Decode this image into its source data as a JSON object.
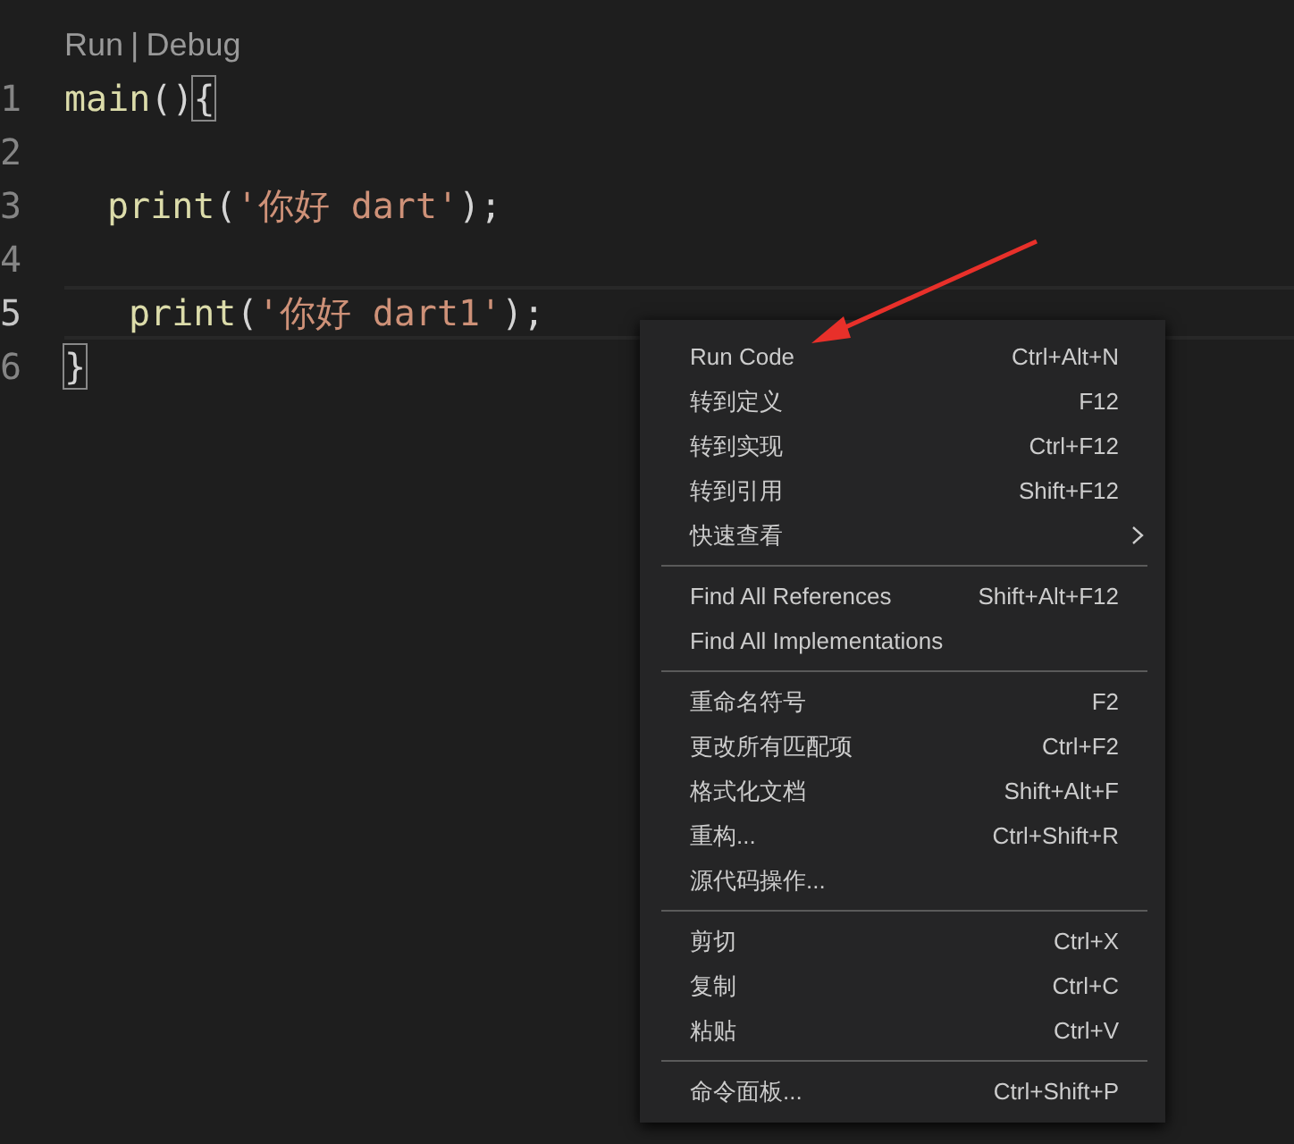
{
  "code_lens": {
    "run": "Run",
    "separator": "|",
    "debug": "Debug"
  },
  "lines": [
    {
      "number": "1",
      "current": false,
      "kind": "top",
      "tokens": [
        {
          "kind": "function",
          "text": "main"
        },
        {
          "kind": "punct",
          "text": "()"
        },
        {
          "kind": "bracket_match",
          "text": "{"
        }
      ]
    },
    {
      "number": "2",
      "current": false,
      "kind": "blank"
    },
    {
      "number": "3",
      "current": false,
      "kind": "body",
      "tokens": [
        {
          "kind": "function",
          "text": "print"
        },
        {
          "kind": "punct",
          "text": "("
        },
        {
          "kind": "string",
          "text": "'你好 dart'"
        },
        {
          "kind": "punct",
          "text": ");"
        }
      ]
    },
    {
      "number": "4",
      "current": false,
      "kind": "blank"
    },
    {
      "number": "5",
      "current": true,
      "kind": "body_extra_space",
      "tokens": [
        {
          "kind": "function",
          "text": "print"
        },
        {
          "kind": "punct",
          "text": "("
        },
        {
          "kind": "string",
          "text": "'你好 dart1'"
        },
        {
          "kind": "punct",
          "text": ");"
        }
      ]
    },
    {
      "number": "6",
      "current": false,
      "kind": "top",
      "tokens": [
        {
          "kind": "bracket_match",
          "text": "}"
        }
      ]
    }
  ],
  "context_menu": {
    "groups": [
      [
        {
          "label": "Run Code",
          "shortcut": "Ctrl+Alt+N",
          "submenu": false
        },
        {
          "label": "转到定义",
          "shortcut": "F12",
          "submenu": false
        },
        {
          "label": "转到实现",
          "shortcut": "Ctrl+F12",
          "submenu": false
        },
        {
          "label": "转到引用",
          "shortcut": "Shift+F12",
          "submenu": false
        },
        {
          "label": "快速查看",
          "submenu": true
        }
      ],
      [
        {
          "label": "Find All References",
          "shortcut": "Shift+Alt+F12",
          "submenu": false
        },
        {
          "label": "Find All Implementations",
          "submenu": false
        }
      ],
      [
        {
          "label": "重命名符号",
          "shortcut": "F2",
          "submenu": false
        },
        {
          "label": "更改所有匹配项",
          "shortcut": "Ctrl+F2",
          "submenu": false
        },
        {
          "label": "格式化文档",
          "shortcut": "Shift+Alt+F",
          "submenu": false
        },
        {
          "label": "重构...",
          "shortcut": "Ctrl+Shift+R",
          "submenu": false
        },
        {
          "label": "源代码操作...",
          "submenu": false
        }
      ],
      [
        {
          "label": "剪切",
          "shortcut": "Ctrl+X",
          "submenu": false
        },
        {
          "label": "复制",
          "shortcut": "Ctrl+C",
          "submenu": false
        },
        {
          "label": "粘贴",
          "shortcut": "Ctrl+V",
          "submenu": false
        }
      ],
      [
        {
          "label": "命令面板...",
          "shortcut": "Ctrl+Shift+P",
          "submenu": false
        }
      ]
    ]
  }
}
